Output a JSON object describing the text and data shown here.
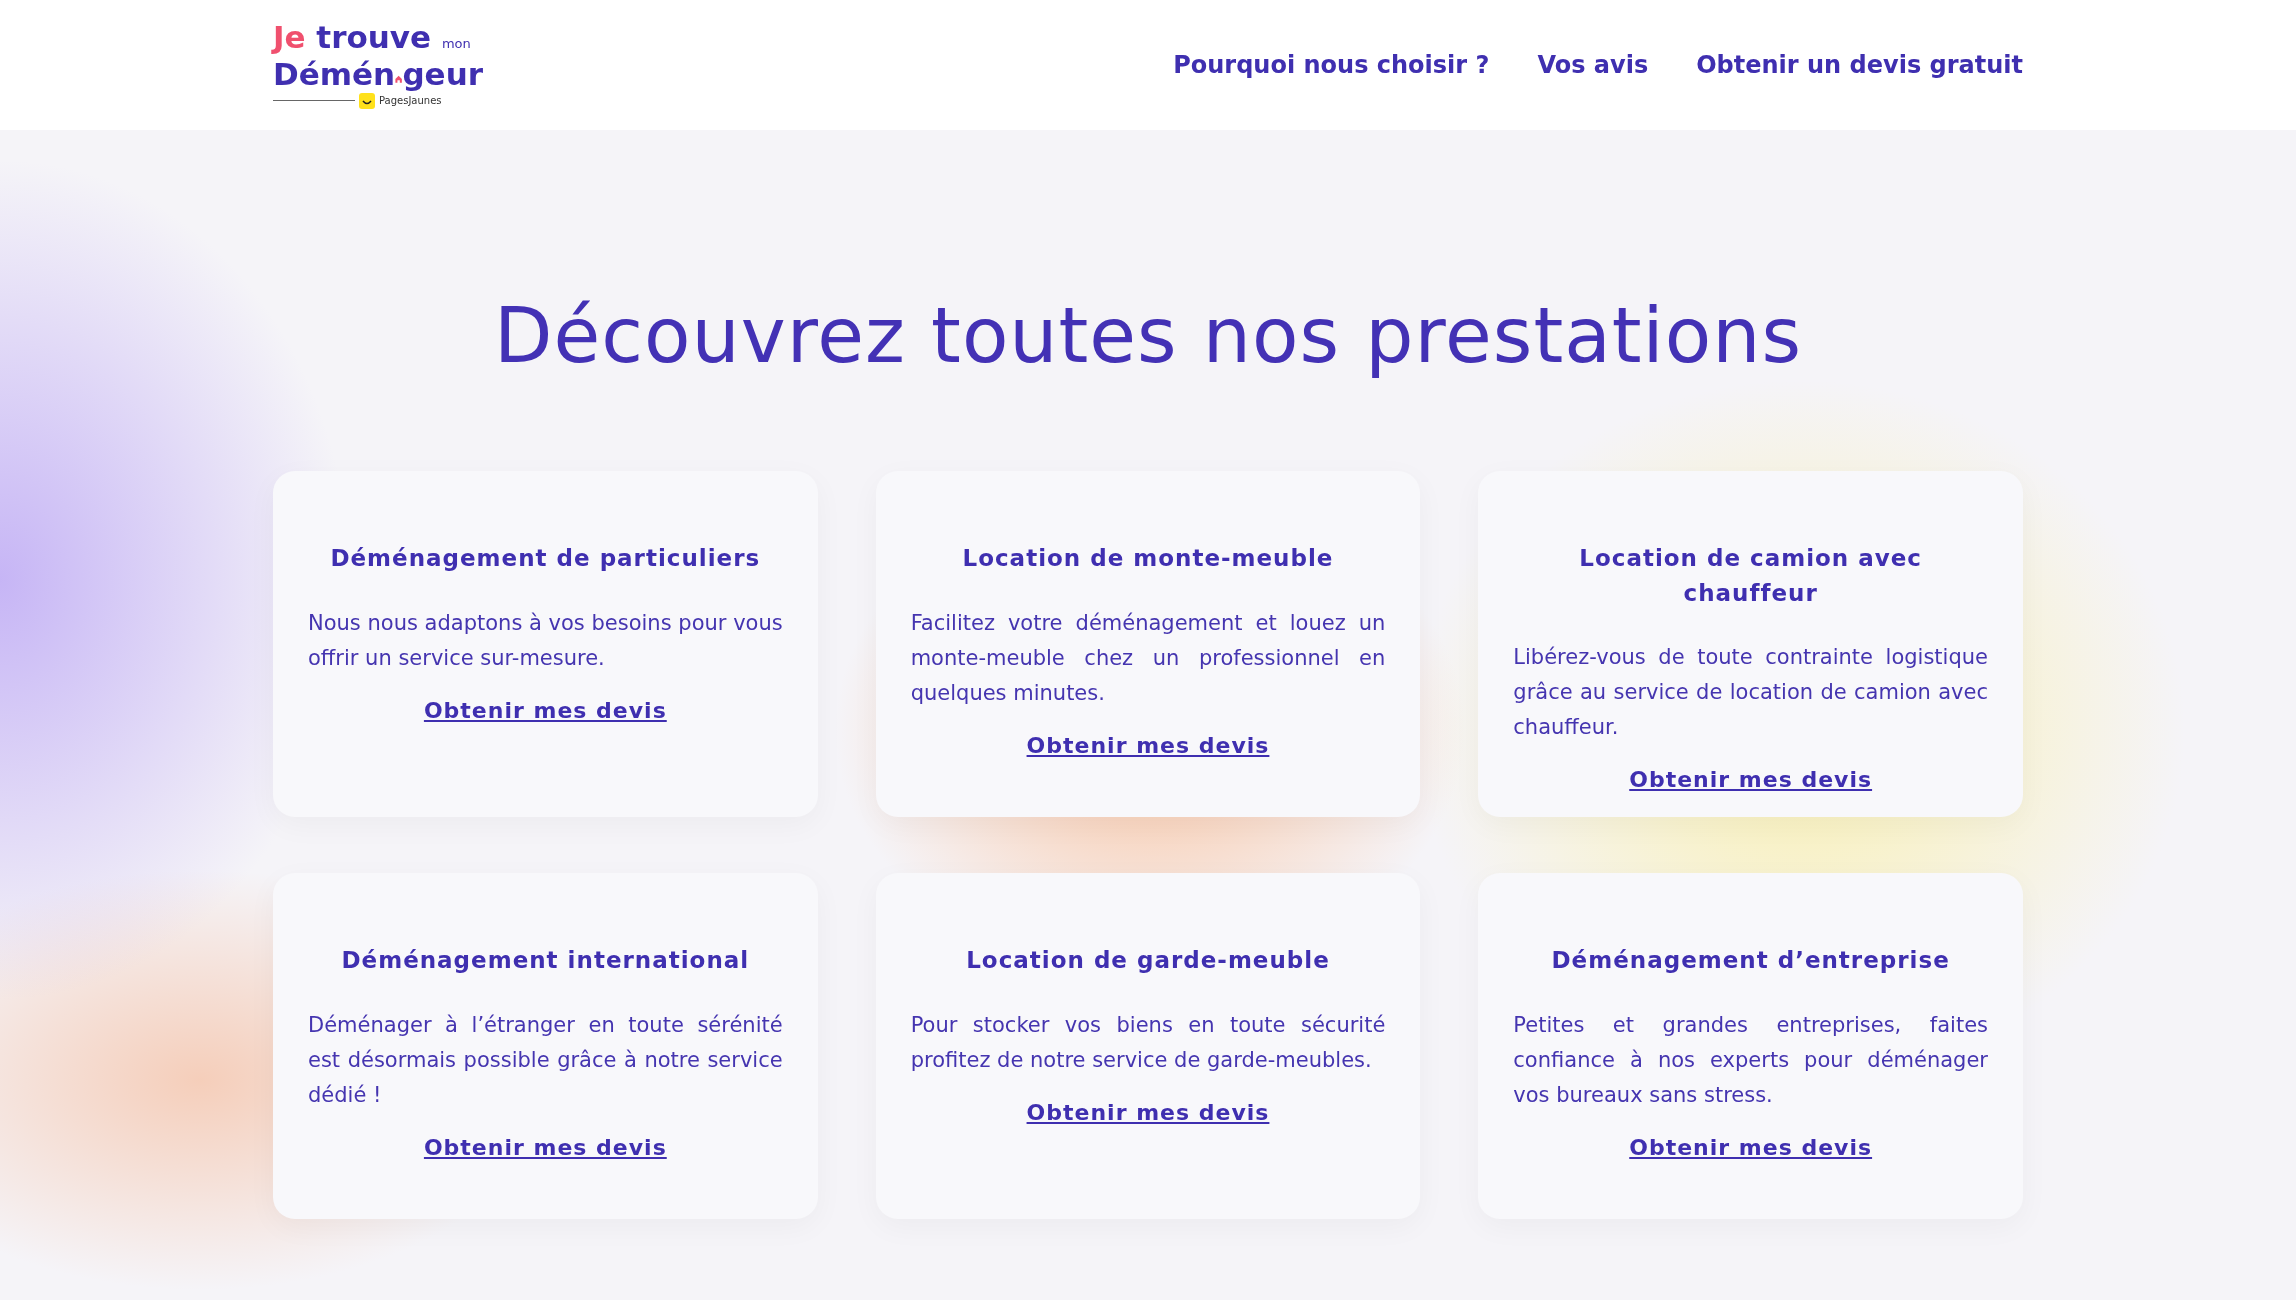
{
  "logo": {
    "word_1": "Je",
    "word_2": "trouve",
    "word_3": "mon",
    "word_4_start": "Démén",
    "word_4_end": "geur",
    "partner": "PagesJaunes"
  },
  "nav": [
    {
      "label": "Pourquoi nous choisir ?"
    },
    {
      "label": "Vos avis"
    },
    {
      "label": "Obtenir un devis gratuit"
    }
  ],
  "heading": "Découvrez toutes nos prestations",
  "services": [
    {
      "title": "Déménagement de particuliers",
      "text": "Nous nous adaptons à vos besoins pour vous offrir un service sur-mesure.",
      "link": "Obtenir mes devis"
    },
    {
      "title": "Location de monte-meuble",
      "text": "Facilitez votre déménagement et louez un monte-meuble chez un professionnel en quelques minutes.",
      "link": "Obtenir mes devis"
    },
    {
      "title": "Location de camion avec chauffeur",
      "text": "Libérez-vous de toute contrainte logistique grâce au service de location de camion avec chauffeur.",
      "link": "Obtenir mes devis"
    },
    {
      "title": "Déménagement international",
      "text": "Déménager à l’étranger en toute sérénité est désormais possible grâce à notre service dédié !",
      "link": "Obtenir mes devis"
    },
    {
      "title": "Location de garde-meuble",
      "text": "Pour stocker vos biens en toute sécurité profitez de notre service de garde-meubles.",
      "link": "Obtenir mes devis"
    },
    {
      "title": "Déménagement d’entreprise",
      "text": "Petites et grandes entreprises, faites confiance à nos experts pour déménager vos bureaux sans stress.",
      "link": "Obtenir mes devis"
    }
  ]
}
